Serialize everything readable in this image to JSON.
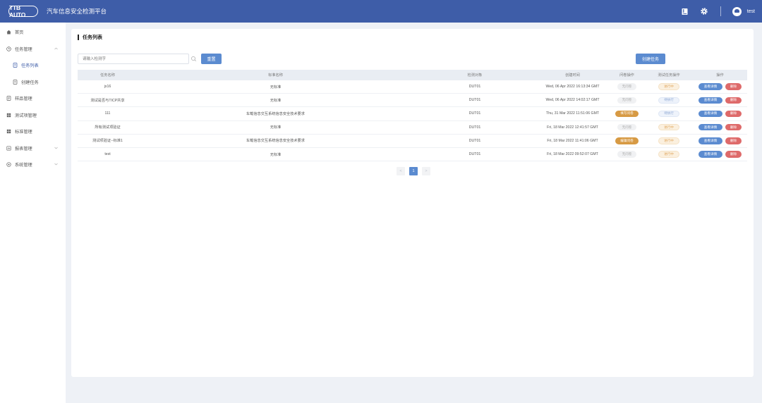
{
  "header": {
    "logo_text": "TTB AUTO",
    "app_title": "汽车信息安全检测平台",
    "username": "test",
    "icons": [
      "book-icon",
      "gear-icon",
      "avatar-icon"
    ]
  },
  "sidebar": {
    "items": [
      {
        "label": "首页",
        "icon": "home-icon"
      },
      {
        "label": "任务管理",
        "icon": "clock-icon",
        "expanded": true
      },
      {
        "label": "任务列表",
        "icon": "document-icon",
        "active": true
      },
      {
        "label": "创建任务",
        "icon": "document-icon"
      },
      {
        "label": "样品管理",
        "icon": "sample-icon"
      },
      {
        "label": "测试项管理",
        "icon": "grid-icon"
      },
      {
        "label": "标准管理",
        "icon": "grid-icon"
      },
      {
        "label": "报表管理",
        "icon": "report-icon"
      },
      {
        "label": "系统管理",
        "icon": "settings-circle-icon"
      }
    ]
  },
  "main": {
    "title": "任务列表",
    "search_placeholder": "请输入检测字",
    "reset_label": "重置",
    "create_label": "创建任务",
    "table": {
      "headers": [
        "任务名称",
        "标准名称",
        "检测对象",
        "创建时间",
        "问卷操作",
        "测试任务操作",
        "操作"
      ],
      "rows": [
        {
          "name": "jx16",
          "standard": "无标准",
          "target": "DUT01",
          "created": "Wed, 06 Apr 2022 16:13:34 GMT",
          "survey": "无问卷",
          "survey_style": "gray",
          "test": "进行中",
          "test_style": "peach",
          "view": "查看详情",
          "delete": "删除"
        },
        {
          "name": "测试是否与TICP共享",
          "standard": "无标准",
          "target": "DUT01",
          "created": "Wed, 06 Apr 2022 14:02:17 GMT",
          "survey": "无问卷",
          "survey_style": "gray",
          "test": "待执行",
          "test_style": "blue",
          "view": "查看详情",
          "delete": "删除"
        },
        {
          "name": "111",
          "standard": "车载信息交互系统信息安全技术要求",
          "target": "DUT01",
          "created": "Thu, 31 Mar 2022 11:51:06 GMT",
          "survey": "填写问卷",
          "survey_style": "orange",
          "test": "待执行",
          "test_style": "blue",
          "view": "查看详情",
          "delete": "删除"
        },
        {
          "name": "所有测试项验证",
          "standard": "无标准",
          "target": "DUT01",
          "created": "Fri, 18 Mar 2022 12:41:57 GMT",
          "survey": "无问卷",
          "survey_style": "gray",
          "test": "进行中",
          "test_style": "peach",
          "view": "查看详情",
          "delete": "删除"
        },
        {
          "name": "测试项验证--标准1",
          "standard": "车载信息交互系统信息安全技术要求",
          "target": "DUT01",
          "created": "Fri, 18 Mar 2022 11:41:06 GMT",
          "survey": "编辑问卷",
          "survey_style": "orange",
          "test": "进行中",
          "test_style": "peach",
          "view": "查看详情",
          "delete": "删除"
        },
        {
          "name": "test",
          "standard": "无标准",
          "target": "DUT01",
          "created": "Fri, 18 Mar 2022 09:52:07 GMT",
          "survey": "无问卷",
          "survey_style": "gray",
          "test": "进行中",
          "test_style": "peach",
          "view": "查看详情",
          "delete": "删除"
        }
      ]
    },
    "pagination": {
      "prev": "<",
      "current": "1",
      "next": ">"
    }
  },
  "colors": {
    "header_bg": "#3e5da8",
    "primary": "#5b8bd0",
    "danger": "#de6a6a",
    "warning": "#d79a44",
    "page_bg": "#eef1f6"
  }
}
